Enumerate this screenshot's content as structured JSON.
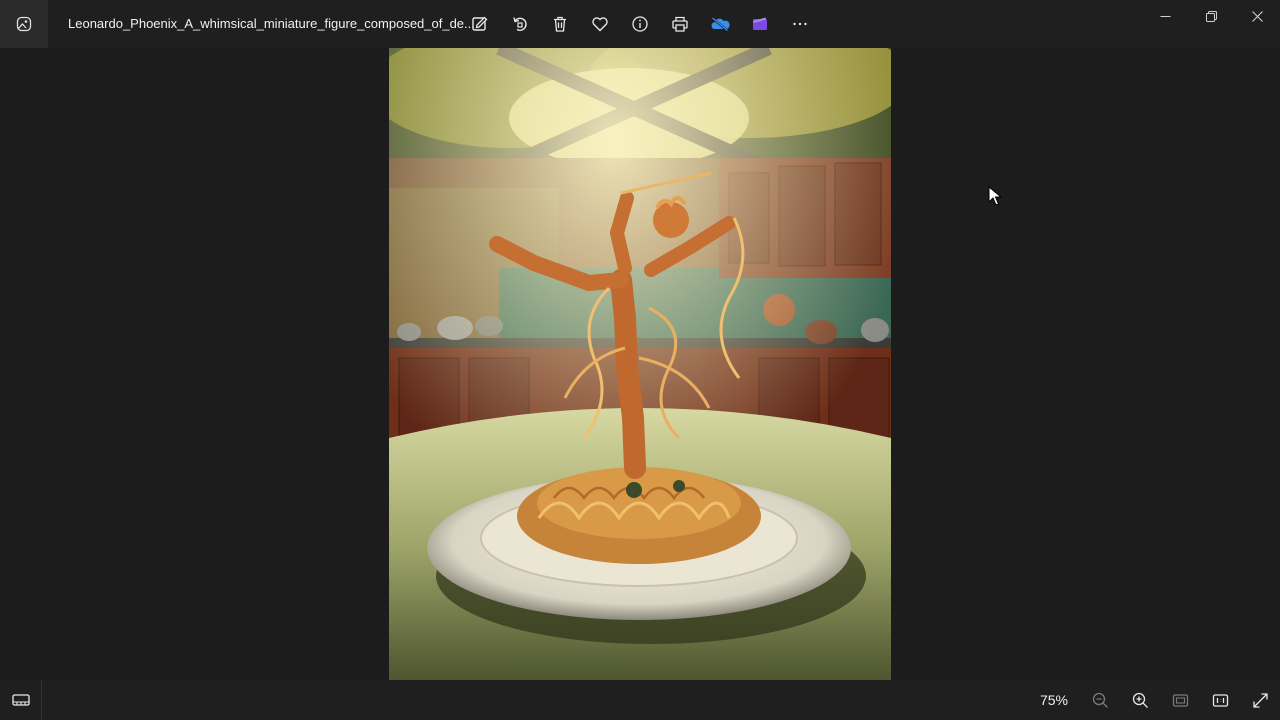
{
  "window": {
    "file_title": "Leonardo_Phoenix_A_whimsical_miniature_figure_composed_of_de..."
  },
  "toolbar": {
    "items": [
      {
        "icon": "edit-image-icon"
      },
      {
        "icon": "rotate-icon"
      },
      {
        "icon": "delete-icon"
      },
      {
        "icon": "favorite-heart-icon"
      },
      {
        "icon": "file-info-icon"
      },
      {
        "icon": "print-icon"
      },
      {
        "icon": "onedrive-cloud-icon"
      },
      {
        "icon": "clipchamp-icon"
      },
      {
        "icon": "more-options-icon"
      }
    ]
  },
  "window_controls": [
    "minimize-icon",
    "restore-icon",
    "close-icon"
  ],
  "statusbar": {
    "zoom_label": "75%"
  },
  "colors": {
    "background": "#1c1c1c",
    "chrome": "#1f1f1f",
    "onedrive_blue": "#3b8eea",
    "clipchamp_purple": "#7b4ae2"
  }
}
